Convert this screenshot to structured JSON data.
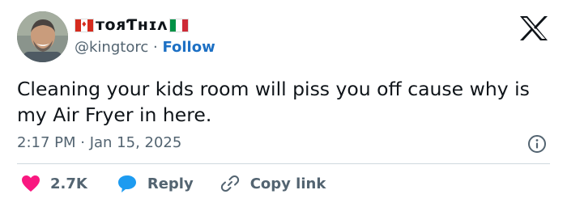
{
  "author": {
    "display_name": "ᴛᴏᴙƬʜɪᴧ",
    "handle": "@kingtorc",
    "separator": "·",
    "follow_label": "Follow",
    "flags": [
      "canada-flag-icon",
      "italy-flag-icon"
    ]
  },
  "tweet": {
    "text": "Cleaning your kids room will piss you off cause why is my Air Fryer in here.",
    "timestamp": "2:17 PM · Jan 15, 2025"
  },
  "actions": {
    "likes": "2.7K",
    "reply_label": "Reply",
    "copy_link_label": "Copy link"
  },
  "icons": [
    "x-logo-icon",
    "info-icon",
    "heart-icon",
    "reply-bubble-icon",
    "link-icon"
  ],
  "colors": {
    "follow": "#1d70c4",
    "heart": "#f91880",
    "reply_bubble": "#1d9bf0",
    "secondary_text": "#536471"
  }
}
